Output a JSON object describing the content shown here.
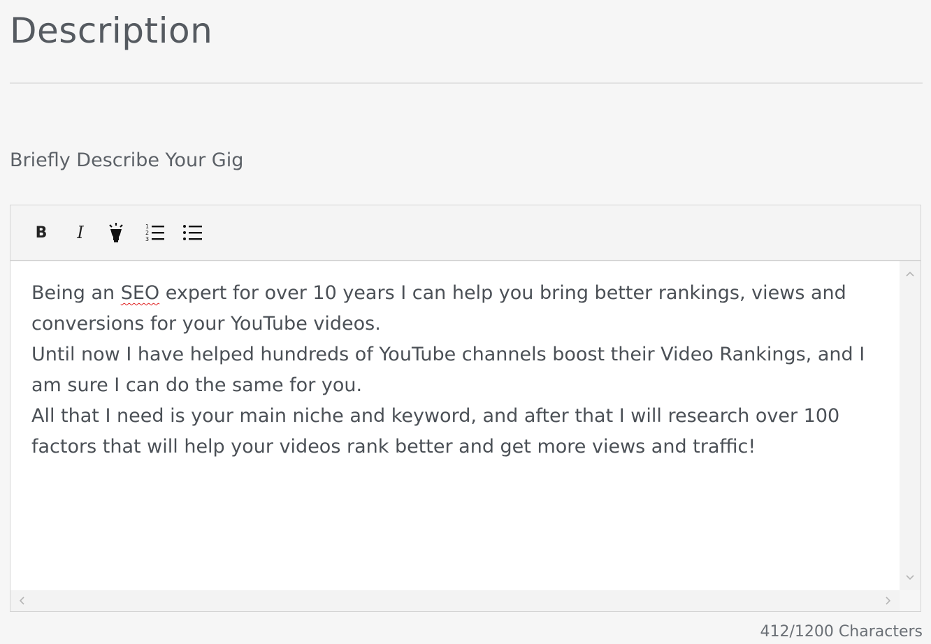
{
  "header": {
    "title": "Description"
  },
  "section": {
    "label": "Briefly Describe Your Gig"
  },
  "toolbar": {
    "bold_label": "B",
    "italic_label": "I",
    "highlight_icon": "lightbulb-icon",
    "ordered_list_icon": "ordered-list-icon",
    "unordered_list_icon": "bullet-list-icon"
  },
  "editor": {
    "line1_pre": "Being an ",
    "line1_misspelled": "SEO",
    "line1_post": " expert for over 10 years I can help you bring better rankings, views and conversions for your YouTube videos.",
    "line2": "Until now I have helped hundreds of YouTube channels boost their Video Rankings, and I am sure I can do the same for you.",
    "line3": "All that I need is your main niche and keyword, and after that I will research over 100 factors that will help your videos rank better and get more views and traffic!"
  },
  "footer": {
    "char_count": "412/1200 Characters"
  },
  "colors": {
    "panel_bg": "#f6f6f6",
    "text": "#4b5056",
    "spellcheck": "#e02020"
  }
}
